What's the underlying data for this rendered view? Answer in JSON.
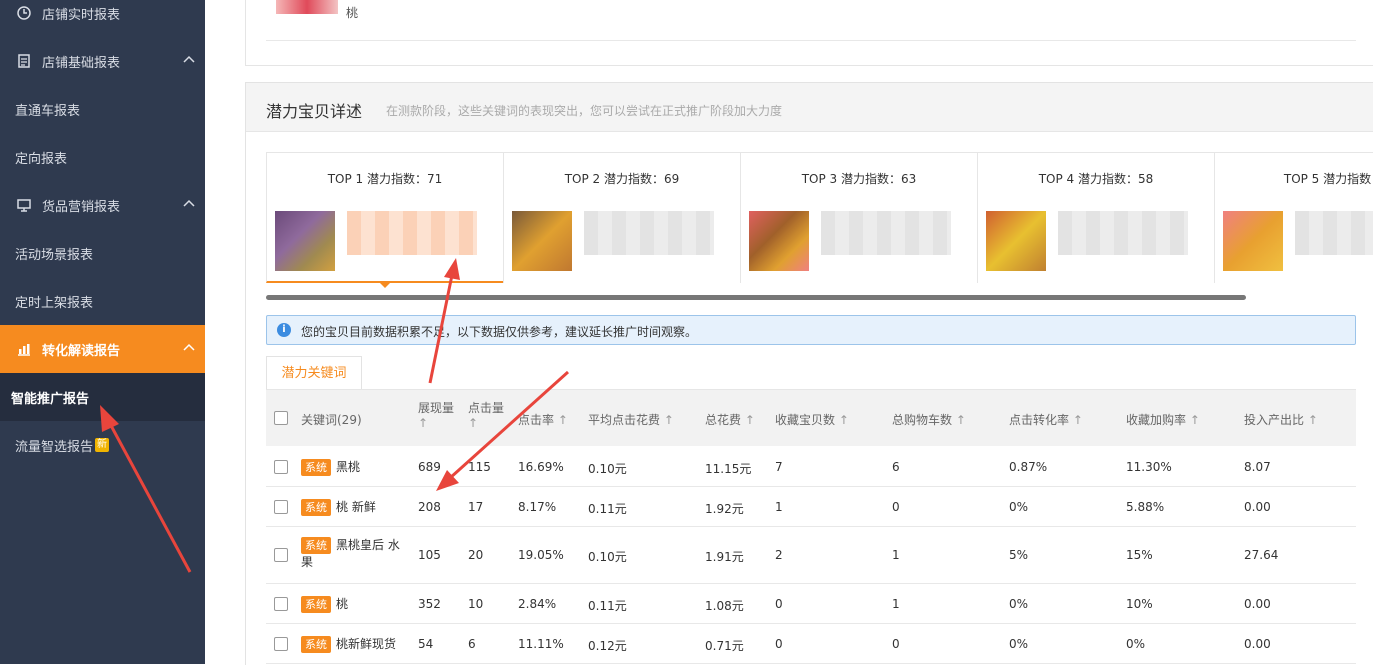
{
  "sidebar": {
    "items": [
      {
        "label": "店铺实时报表"
      },
      {
        "label": "店铺基础报表"
      },
      {
        "label": "直通车报表"
      },
      {
        "label": "定向报表"
      },
      {
        "label": "货品营销报表"
      },
      {
        "label": "活动场景报表"
      },
      {
        "label": "定时上架报表"
      },
      {
        "label": "转化解读报告"
      },
      {
        "label": "智能推广报告"
      },
      {
        "label": "流量智选报告",
        "badge": "新"
      }
    ]
  },
  "top_card": {
    "product_name": "桃"
  },
  "detail": {
    "title": "潜力宝贝详述",
    "subtitle": "在测款阶段，这些关键词的表现突出，您可以尝试在正式推广阶段加大力度",
    "top_tabs": [
      {
        "label": "TOP 1   潜力指数：71"
      },
      {
        "label": "TOP 2   潜力指数：69"
      },
      {
        "label": "TOP 3   潜力指数：63"
      },
      {
        "label": "TOP 4   潜力指数：58"
      },
      {
        "label": "TOP 5   潜力指数："
      }
    ],
    "info_text": "您的宝贝目前数据积累不足，以下数据仅供参考，建议延长推广时间观察。",
    "keyword_tab": "潜力关键词",
    "table": {
      "headers": {
        "keyword": "关键词(29)",
        "impressions": "展现量",
        "clicks": "点击量",
        "ctr": "点击率",
        "avg_cpc": "平均点击花费",
        "total_cost": "总花费",
        "favorites": "收藏宝贝数",
        "carts": "总购物车数",
        "cvr": "点击转化率",
        "fav_cart_rate": "收藏加购率",
        "roi": "投入产出比"
      },
      "sort_arrow": "↑",
      "tag": "系统",
      "rows": [
        {
          "keyword": "黑桃",
          "impressions": "689",
          "clicks": "115",
          "ctr": "16.69%",
          "avg_cpc": "0.10元",
          "total_cost": "11.15元",
          "favorites": "7",
          "carts": "6",
          "cvr": "0.87%",
          "fav_cart_rate": "11.30%",
          "roi": "8.07"
        },
        {
          "keyword": "桃 新鲜",
          "impressions": "208",
          "clicks": "17",
          "ctr": "8.17%",
          "avg_cpc": "0.11元",
          "total_cost": "1.92元",
          "favorites": "1",
          "carts": "0",
          "cvr": "0%",
          "fav_cart_rate": "5.88%",
          "roi": "0.00"
        },
        {
          "keyword": "黑桃皇后 水果",
          "impressions": "105",
          "clicks": "20",
          "ctr": "19.05%",
          "avg_cpc": "0.10元",
          "total_cost": "1.91元",
          "favorites": "2",
          "carts": "1",
          "cvr": "5%",
          "fav_cart_rate": "15%",
          "roi": "27.64"
        },
        {
          "keyword": "桃",
          "impressions": "352",
          "clicks": "10",
          "ctr": "2.84%",
          "avg_cpc": "0.11元",
          "total_cost": "1.08元",
          "favorites": "0",
          "carts": "1",
          "cvr": "0%",
          "fav_cart_rate": "10%",
          "roi": "0.00"
        },
        {
          "keyword": "桃新鲜现货",
          "impressions": "54",
          "clicks": "6",
          "ctr": "11.11%",
          "avg_cpc": "0.12元",
          "total_cost": "0.71元",
          "favorites": "0",
          "carts": "0",
          "cvr": "0%",
          "fav_cart_rate": "0%",
          "roi": "0.00"
        }
      ]
    }
  },
  "colors": {
    "accent": "#f68b1f",
    "sidebar_bg": "#2f3a4f",
    "annotation_arrow": "#e8453c"
  }
}
